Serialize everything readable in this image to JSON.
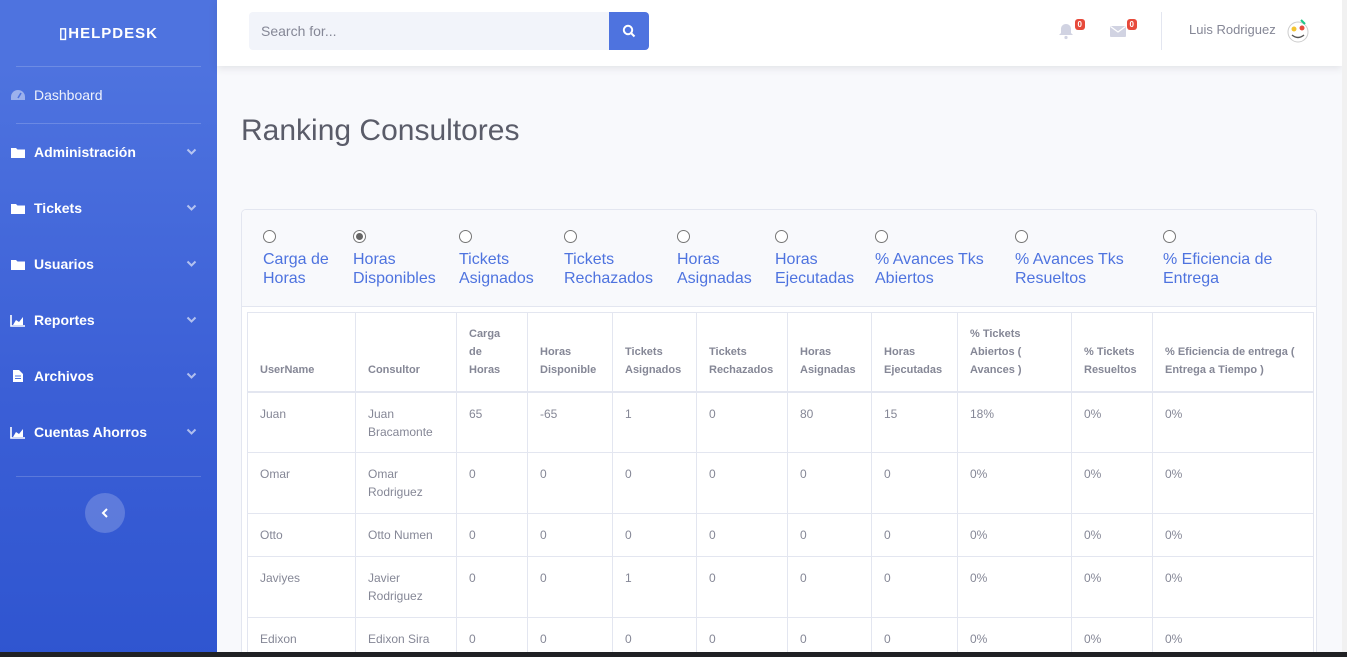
{
  "sidebar": {
    "brand": "▯HELPDESK",
    "dashboard": "Dashboard",
    "items": [
      {
        "label": "Administración",
        "icon": "folder-icon"
      },
      {
        "label": "Tickets",
        "icon": "folder-icon"
      },
      {
        "label": "Usuarios",
        "icon": "folder-icon"
      },
      {
        "label": "Reportes",
        "icon": "chart-area-icon"
      },
      {
        "label": "Archivos",
        "icon": "file-icon"
      },
      {
        "label": "Cuentas Ahorros",
        "icon": "chart-area-icon"
      }
    ]
  },
  "topbar": {
    "search_placeholder": "Search for...",
    "alerts_count": "0",
    "messages_count": "0",
    "user_name": "Luis Rodriguez"
  },
  "page": {
    "title": "Ranking Consultores"
  },
  "options": [
    {
      "line1": "Carga de",
      "line2": "Horas",
      "selected": false
    },
    {
      "line1": "Horas",
      "line2": "Disponibles",
      "selected": true
    },
    {
      "line1": "Tickets",
      "line2": "Asignados",
      "selected": false
    },
    {
      "line1": "Tickets",
      "line2": "Rechazados",
      "selected": false
    },
    {
      "line1": "Horas",
      "line2": "Asignadas",
      "selected": false
    },
    {
      "line1": "Horas",
      "line2": "Ejecutadas",
      "selected": false
    },
    {
      "line1": "% Avances Tks",
      "line2": "Abiertos",
      "selected": false
    },
    {
      "line1": "% Avances Tks",
      "line2": "Resueltos",
      "selected": false
    },
    {
      "line1": "% Eficiencia de",
      "line2": "Entrega",
      "selected": false
    }
  ],
  "table": {
    "headers": [
      "UserName",
      "Consultor",
      "Carga de Horas",
      "Horas Disponible",
      "Tickets Asignados",
      "Tickets Rechazados",
      "Horas Asignadas",
      "Horas Ejecutadas",
      "% Tickets Abiertos ( Avances )",
      "% Tickets Resueltos",
      "% Eficiencia de entrega ( Entrega a Tiempo )"
    ],
    "rows": [
      [
        "Juan",
        "Juan Bracamonte",
        "65",
        "-65",
        "1",
        "0",
        "80",
        "15",
        "18%",
        "0%",
        "0%"
      ],
      [
        "Omar",
        "Omar Rodriguez",
        "0",
        "0",
        "0",
        "0",
        "0",
        "0",
        "0%",
        "0%",
        "0%"
      ],
      [
        "Otto",
        "Otto Numen",
        "0",
        "0",
        "0",
        "0",
        "0",
        "0",
        "0%",
        "0%",
        "0%"
      ],
      [
        "Javiyes",
        "Javier Rodriguez",
        "0",
        "0",
        "1",
        "0",
        "0",
        "0",
        "0%",
        "0%",
        "0%"
      ],
      [
        "Edixon",
        "Edixon Sira",
        "0",
        "0",
        "0",
        "0",
        "0",
        "0",
        "0%",
        "0%",
        "0%"
      ]
    ]
  },
  "colors": {
    "primary": "#4e73df",
    "badge": "#e74a3b"
  }
}
